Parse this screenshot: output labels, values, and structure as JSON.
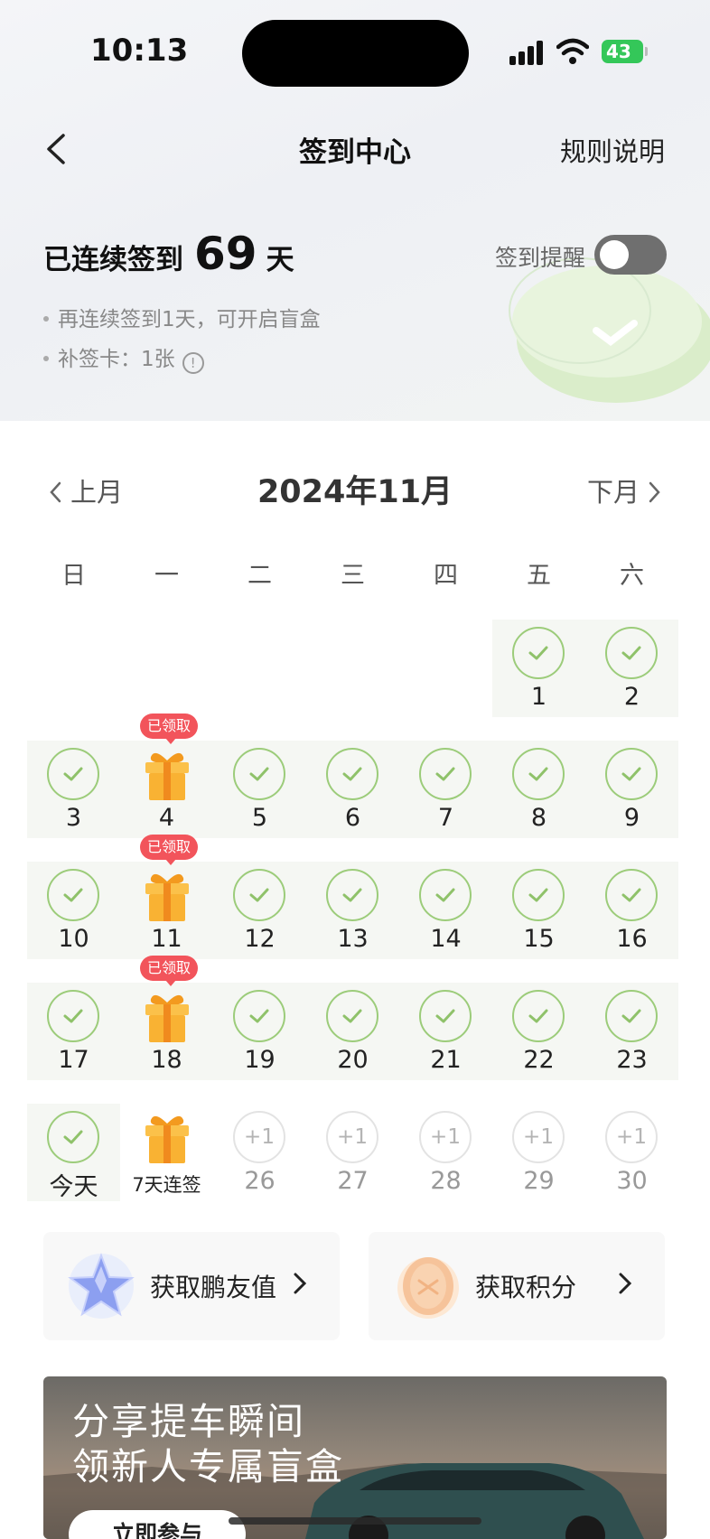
{
  "status": {
    "time": "10:13",
    "battery": "43"
  },
  "nav": {
    "title": "签到中心",
    "rules": "规则说明"
  },
  "streak": {
    "prefix": "已连续签到",
    "days": "69",
    "suffix": "天"
  },
  "reminder": {
    "label": "签到提醒",
    "enabled": false
  },
  "tips": [
    "再连续签到1天，可开启盲盒",
    "补签卡：1张"
  ],
  "calendar": {
    "prev": "上月",
    "month": "2024年11月",
    "next": "下月",
    "weekdays": [
      "日",
      "一",
      "二",
      "三",
      "四",
      "五",
      "六"
    ],
    "claimed_label": "已领取",
    "weeks": [
      [
        null,
        null,
        null,
        null,
        null,
        {
          "label": "1",
          "state": "checked"
        },
        {
          "label": "2",
          "state": "checked"
        }
      ],
      [
        {
          "label": "3",
          "state": "checked"
        },
        {
          "label": "4",
          "state": "gift-claimed"
        },
        {
          "label": "5",
          "state": "checked"
        },
        {
          "label": "6",
          "state": "checked"
        },
        {
          "label": "7",
          "state": "checked"
        },
        {
          "label": "8",
          "state": "checked"
        },
        {
          "label": "9",
          "state": "checked"
        }
      ],
      [
        {
          "label": "10",
          "state": "checked"
        },
        {
          "label": "11",
          "state": "gift-claimed"
        },
        {
          "label": "12",
          "state": "checked"
        },
        {
          "label": "13",
          "state": "checked"
        },
        {
          "label": "14",
          "state": "checked"
        },
        {
          "label": "15",
          "state": "checked"
        },
        {
          "label": "16",
          "state": "checked"
        }
      ],
      [
        {
          "label": "17",
          "state": "checked"
        },
        {
          "label": "18",
          "state": "gift-claimed"
        },
        {
          "label": "19",
          "state": "checked"
        },
        {
          "label": "20",
          "state": "checked"
        },
        {
          "label": "21",
          "state": "checked"
        },
        {
          "label": "22",
          "state": "checked"
        },
        {
          "label": "23",
          "state": "checked"
        }
      ],
      [
        {
          "label": "今天",
          "state": "checked"
        },
        {
          "label": "7天连签",
          "state": "gift"
        },
        {
          "label": "26",
          "state": "future",
          "reward": "+1"
        },
        {
          "label": "27",
          "state": "future",
          "reward": "+1"
        },
        {
          "label": "28",
          "state": "future",
          "reward": "+1"
        },
        {
          "label": "29",
          "state": "future",
          "reward": "+1"
        },
        {
          "label": "30",
          "state": "future",
          "reward": "+1"
        }
      ]
    ]
  },
  "cards": [
    {
      "label": "获取鹏友值",
      "icon": "star-icon"
    },
    {
      "label": "获取积分",
      "icon": "coin-icon"
    }
  ],
  "banner": {
    "line1": "分享提车瞬间",
    "line2": "领新人专属盲盒",
    "button": "立即参与"
  },
  "colors": {
    "check": "#9ccc7a",
    "badge": "#f2545b",
    "gift": "#f7b733"
  }
}
